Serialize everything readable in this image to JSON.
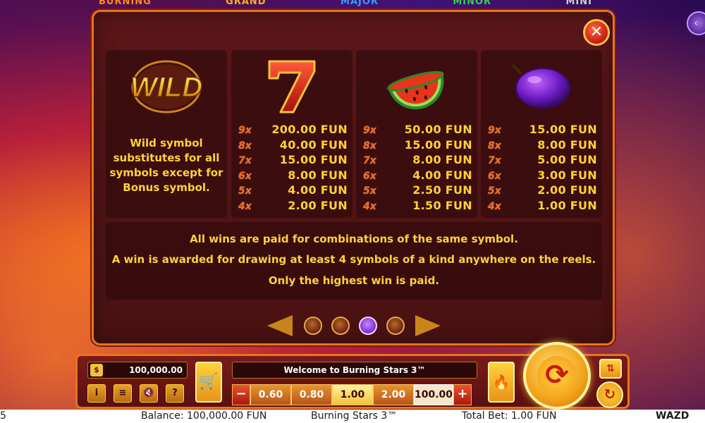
{
  "colors": {
    "accent_gold": "#ffd23a",
    "panel_bg": "#5a1618",
    "border_orange": "#e8741c",
    "multiplier": "#e96a2a"
  },
  "jackpots": [
    {
      "label": "BURNING",
      "color": "#ff8a1a"
    },
    {
      "label": "GRAND",
      "color": "#ffb01a"
    },
    {
      "label": "MAJOR",
      "color": "#3a9aff"
    },
    {
      "label": "MINOR",
      "color": "#3ad04a"
    },
    {
      "label": "MINI",
      "color": "#cfcfcf"
    }
  ],
  "paytable": {
    "close_icon": "close-icon",
    "wild": {
      "logo_text": "WILD",
      "description_lines": [
        "Wild symbol",
        "substitutes for all",
        "symbols except for",
        "Bonus symbol."
      ]
    },
    "symbols": [
      {
        "name": "seven",
        "pays": [
          {
            "mult": "9x",
            "amount": "200.00 FUN"
          },
          {
            "mult": "8x",
            "amount": "40.00 FUN"
          },
          {
            "mult": "7x",
            "amount": "15.00 FUN"
          },
          {
            "mult": "6x",
            "amount": "8.00 FUN"
          },
          {
            "mult": "5x",
            "amount": "4.00 FUN"
          },
          {
            "mult": "4x",
            "amount": "2.00 FUN"
          }
        ]
      },
      {
        "name": "watermelon",
        "pays": [
          {
            "mult": "9x",
            "amount": "50.00 FUN"
          },
          {
            "mult": "8x",
            "amount": "15.00 FUN"
          },
          {
            "mult": "7x",
            "amount": "8.00 FUN"
          },
          {
            "mult": "6x",
            "amount": "4.00 FUN"
          },
          {
            "mult": "5x",
            "amount": "2.50 FUN"
          },
          {
            "mult": "4x",
            "amount": "1.50 FUN"
          }
        ]
      },
      {
        "name": "plum",
        "pays": [
          {
            "mult": "9x",
            "amount": "15.00 FUN"
          },
          {
            "mult": "8x",
            "amount": "8.00 FUN"
          },
          {
            "mult": "7x",
            "amount": "5.00 FUN"
          },
          {
            "mult": "6x",
            "amount": "3.00 FUN"
          },
          {
            "mult": "5x",
            "amount": "2.00 FUN"
          },
          {
            "mult": "4x",
            "amount": "1.00 FUN"
          }
        ]
      }
    ],
    "rules": [
      "All wins are paid for combinations of the same symbol.",
      "A win is awarded for drawing at least 4 symbols of a kind anywhere on the reels.",
      "Only the highest win is paid."
    ],
    "pager": {
      "total_pages": 4,
      "current_page": 3
    }
  },
  "controls": {
    "balance_value": "100,000.00",
    "message": "Welcome to Burning Stars 3™",
    "bet_minus": "−",
    "bet_plus": "+",
    "bet_options": [
      "0.60",
      "0.80",
      "1.00",
      "2.00",
      "100.00"
    ],
    "selected_bet": "1.00",
    "info_label": "i",
    "menu_label": "≡",
    "sound_label": "🔇",
    "help_label": "?"
  },
  "status_bar": {
    "left_number": "5",
    "balance": "Balance: 100,000.00 FUN",
    "game_title": "Burning Stars 3™",
    "total_bet": "Total Bet: 1.00 FUN",
    "provider": "WAZD"
  }
}
